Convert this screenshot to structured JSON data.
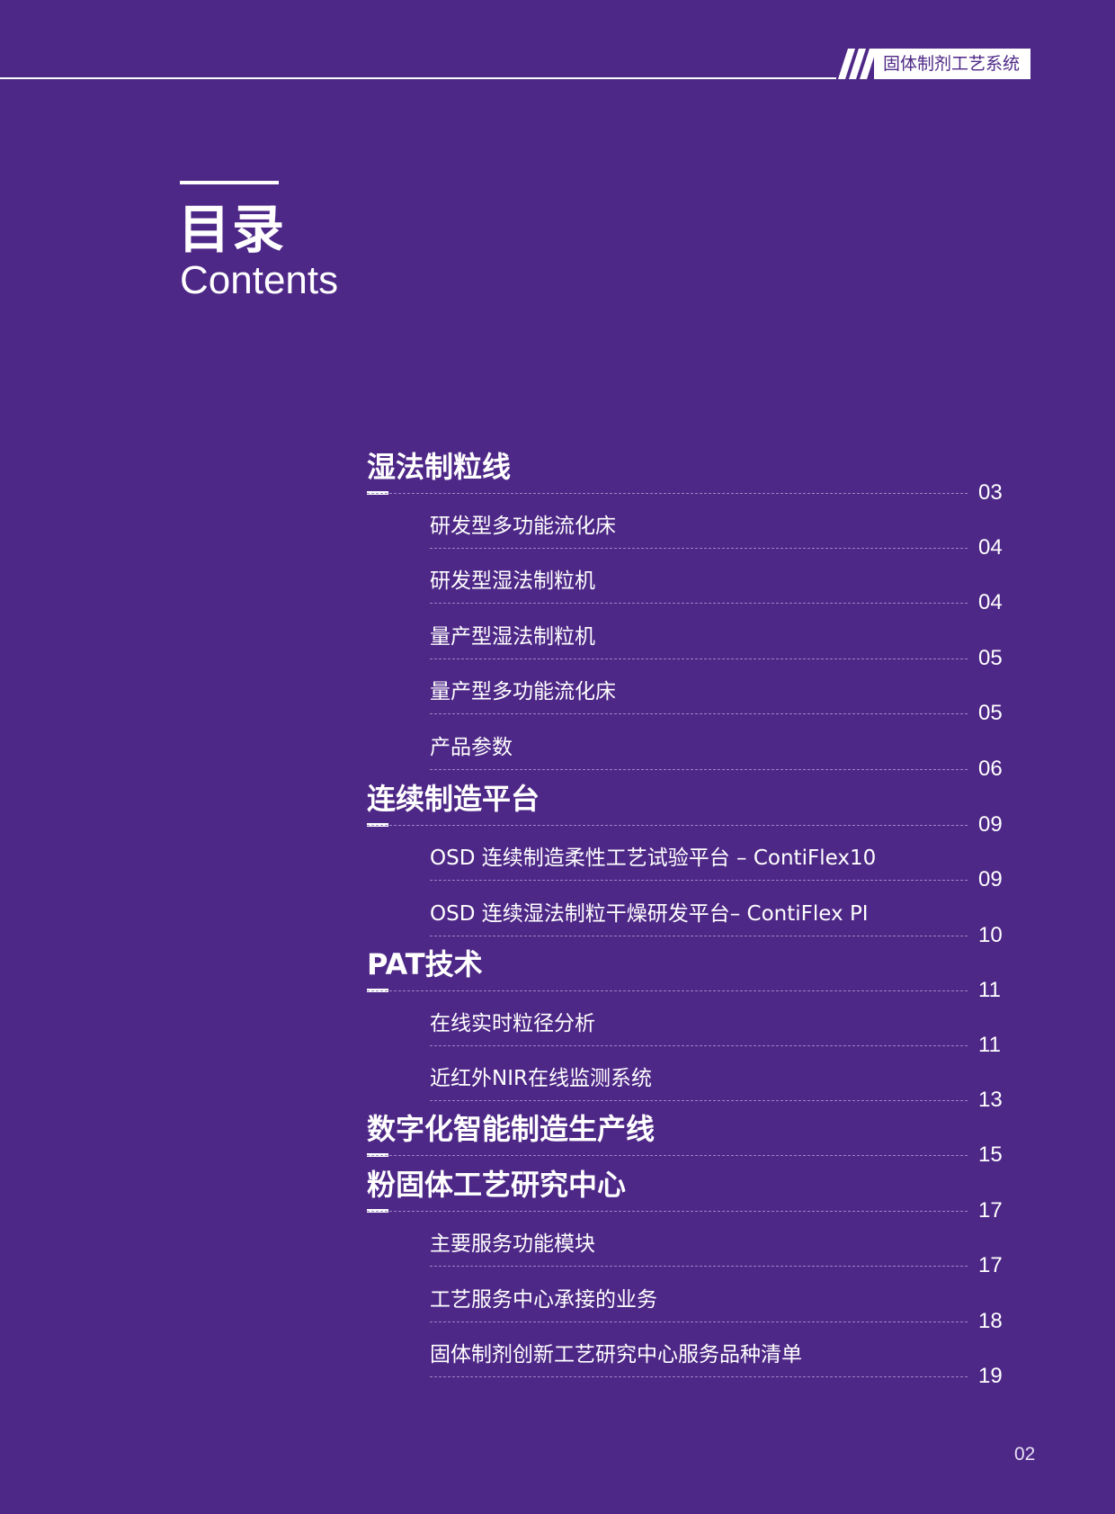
{
  "header": {
    "tag": "固体制剂工艺系统"
  },
  "title": {
    "cn": "目录",
    "en": "Contents"
  },
  "toc": [
    {
      "label": "湿法制粒线",
      "page": "03",
      "level": "major"
    },
    {
      "label": "研发型多功能流化床",
      "page": "04",
      "level": "minor"
    },
    {
      "label": "研发型湿法制粒机",
      "page": "04",
      "level": "minor"
    },
    {
      "label": "量产型湿法制粒机",
      "page": "05",
      "level": "minor"
    },
    {
      "label": "量产型多功能流化床",
      "page": "05",
      "level": "minor"
    },
    {
      "label": "产品参数",
      "page": "06",
      "level": "minor"
    },
    {
      "label": "连续制造平台",
      "page": "09",
      "level": "major"
    },
    {
      "label": "OSD 连续制造柔性工艺试验平台 – ContiFlex10",
      "page": "09",
      "level": "minor"
    },
    {
      "label": "OSD 连续湿法制粒干燥研发平台– ContiFlex PI",
      "page": "10",
      "level": "minor"
    },
    {
      "label": "PAT技术",
      "page": "11",
      "level": "major"
    },
    {
      "label": "在线实时粒径分析",
      "page": "11",
      "level": "minor"
    },
    {
      "label": "近红外NIR在线监测系统",
      "page": "13",
      "level": "minor"
    },
    {
      "label": "数字化智能制造生产线",
      "page": "15",
      "level": "major"
    },
    {
      "label": "粉固体工艺研究中心",
      "page": "17",
      "level": "major"
    },
    {
      "label": "主要服务功能模块",
      "page": "17",
      "level": "minor"
    },
    {
      "label": "工艺服务中心承接的业务",
      "page": "18",
      "level": "minor"
    },
    {
      "label": "固体制剂创新工艺研究中心服务品种清单",
      "page": "19",
      "level": "minor"
    }
  ],
  "footer": {
    "page_number": "02"
  },
  "colors": {
    "background": "#4e2887",
    "text": "#ffffff",
    "dashed_rule": "#9b84c2"
  }
}
